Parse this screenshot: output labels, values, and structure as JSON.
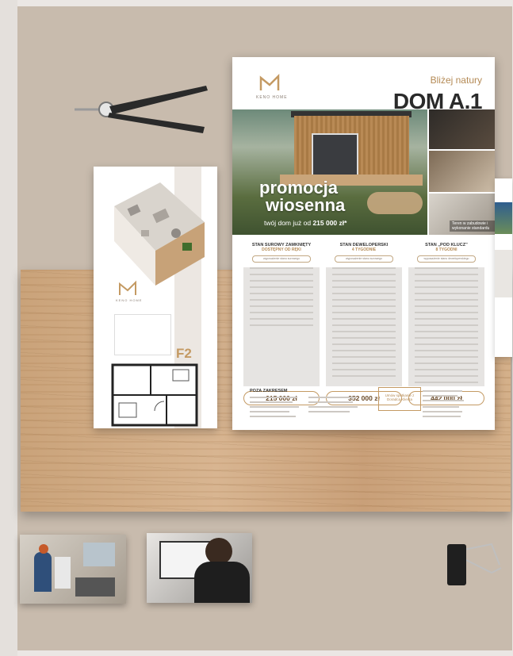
{
  "flyer": {
    "tagline": "Bliżej natury",
    "title": "DOM A.1",
    "brand": "KENO HOME",
    "promo_line1": "promocja",
    "promo_line2": "wiosenna",
    "promo_sub_prefix": "twój dom już od",
    "promo_sub_price": "215 000 zł*",
    "thumb_caption": "Teren w zabudowie i wykonanie standardu",
    "columns": [
      {
        "heading": "STAN SUROWY ZAMKNIĘTY",
        "subheading": "DOSTĘPNY OD RĘKI",
        "note": "wyposażenie stanu surowego",
        "price": "215 000 zł"
      },
      {
        "heading": "STAN DEWELOPERSKI",
        "subheading": "4 TYGODNIE",
        "note": "wyposażenie stanu surowego",
        "price": "352 000 zł"
      },
      {
        "heading": "STAN „POD KLUCZ”",
        "subheading": "8 TYGODNI",
        "note": "wyposażenie stanu deweloperskiego",
        "price": "442 000 zł"
      }
    ],
    "poza_zakresem": "POZA ZAKRESEM",
    "umow": "Umów spotkanie z Doradcą Klienta"
  },
  "card_f2": {
    "brand": "KENO HOME",
    "label": "F2"
  },
  "colors": {
    "accent": "#c49a63",
    "desk": "#c8bbad",
    "wood": "#d8b591"
  }
}
